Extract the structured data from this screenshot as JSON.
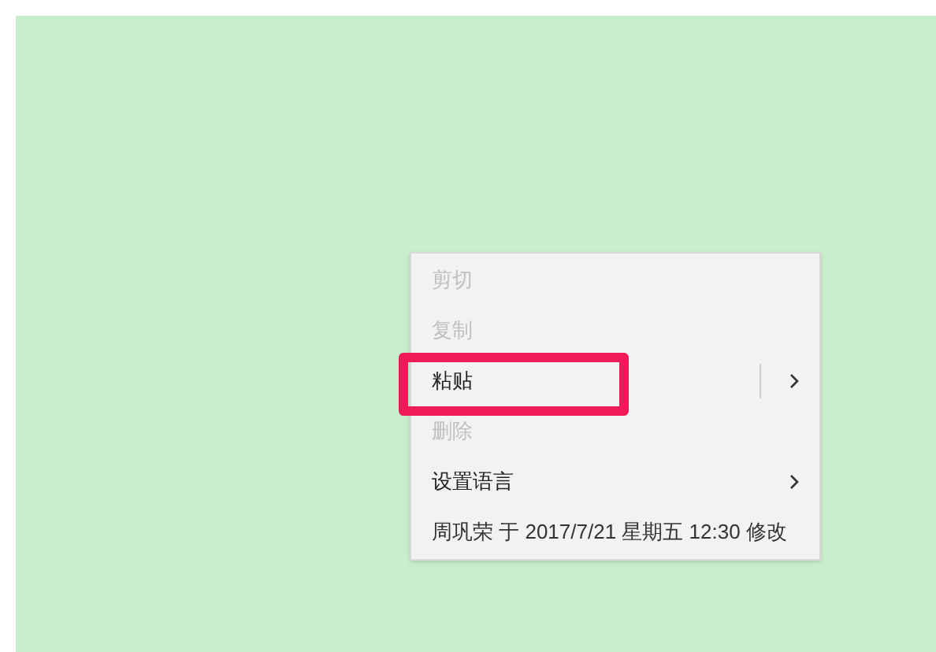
{
  "context_menu": {
    "items": [
      {
        "kind": "action",
        "label": "剪切",
        "disabled": true
      },
      {
        "kind": "action",
        "label": "复制",
        "disabled": true
      },
      {
        "kind": "action",
        "label": "粘贴",
        "disabled": false,
        "submenu": true,
        "split": true,
        "highlighted": true
      },
      {
        "kind": "action",
        "label": "删除",
        "disabled": true
      },
      {
        "kind": "action",
        "label": "设置语言",
        "disabled": false,
        "submenu": true
      },
      {
        "kind": "info",
        "label": "周巩荣 于 2017/7/21 星期五 12:30 修改"
      }
    ]
  }
}
